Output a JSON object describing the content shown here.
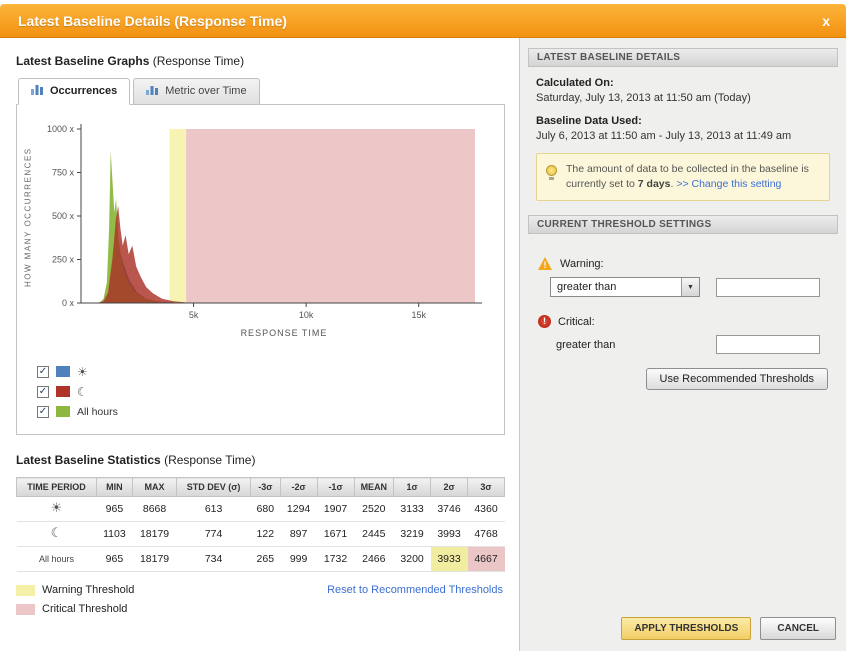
{
  "dialog": {
    "title": "Latest Baseline Details (Response Time)",
    "close_label": "x"
  },
  "graphs": {
    "heading_bold": "Latest Baseline Graphs",
    "heading_suffix": " (Response Time)",
    "tabs": [
      {
        "label": "Occurrences",
        "active": true
      },
      {
        "label": "Metric over Time",
        "active": false
      }
    ]
  },
  "chart_data": {
    "type": "area",
    "title": "",
    "xlabel": "RESPONSE TIME",
    "ylabel": "HOW MANY OCCURRENCES",
    "xlim": [
      0,
      17500
    ],
    "ylim": [
      0,
      1000
    ],
    "x_ticks": [
      {
        "value": 5000,
        "label": "5k"
      },
      {
        "value": 10000,
        "label": "10k"
      },
      {
        "value": 15000,
        "label": "15k"
      }
    ],
    "y_ticks": [
      {
        "value": 0,
        "label": "0 x"
      },
      {
        "value": 250,
        "label": "250 x"
      },
      {
        "value": 500,
        "label": "500 x"
      },
      {
        "value": 750,
        "label": "750 x"
      },
      {
        "value": 1000,
        "label": "1000 x"
      }
    ],
    "thresholds": {
      "warning_start": 3933,
      "critical_start": 4667,
      "warning_color": "#f7f3b3",
      "critical_color": "#edc7c7"
    },
    "series": [
      {
        "name": "Day",
        "color": "#4f81bd",
        "opacity": 1,
        "points": [
          [
            800,
            0
          ],
          [
            1100,
            15
          ],
          [
            1350,
            120
          ],
          [
            1550,
            260
          ],
          [
            1700,
            310
          ],
          [
            1900,
            220
          ],
          [
            2150,
            130
          ],
          [
            2500,
            60
          ],
          [
            2900,
            25
          ],
          [
            3400,
            8
          ],
          [
            4000,
            0
          ]
        ]
      },
      {
        "name": "All hours",
        "color": "#8db73e",
        "opacity": 0.95,
        "points": [
          [
            500,
            0
          ],
          [
            850,
            4
          ],
          [
            1000,
            25
          ],
          [
            1150,
            120
          ],
          [
            1250,
            430
          ],
          [
            1320,
            870
          ],
          [
            1400,
            700
          ],
          [
            1480,
            520
          ],
          [
            1560,
            600
          ],
          [
            1650,
            380
          ],
          [
            1750,
            290
          ],
          [
            1900,
            190
          ],
          [
            2100,
            120
          ],
          [
            2350,
            70
          ],
          [
            2650,
            38
          ],
          [
            3000,
            18
          ],
          [
            3500,
            8
          ],
          [
            4200,
            3
          ],
          [
            5000,
            0
          ]
        ]
      },
      {
        "name": "Night",
        "color": "#a93126",
        "opacity": 0.82,
        "points": [
          [
            700,
            0
          ],
          [
            1000,
            10
          ],
          [
            1200,
            60
          ],
          [
            1400,
            260
          ],
          [
            1550,
            480
          ],
          [
            1650,
            560
          ],
          [
            1750,
            430
          ],
          [
            1850,
            330
          ],
          [
            1980,
            390
          ],
          [
            2120,
            280
          ],
          [
            2280,
            330
          ],
          [
            2450,
            210
          ],
          [
            2650,
            150
          ],
          [
            2900,
            90
          ],
          [
            3200,
            55
          ],
          [
            3600,
            25
          ],
          [
            4100,
            10
          ],
          [
            4700,
            3
          ],
          [
            5400,
            0
          ]
        ]
      }
    ]
  },
  "legend_checkboxes": [
    {
      "icon": "sun-icon",
      "color": "#4f81bd",
      "checked": true,
      "label": ""
    },
    {
      "icon": "moon-icon",
      "color": "#b03329",
      "checked": true,
      "label": ""
    },
    {
      "icon": null,
      "color": "#8db73e",
      "checked": true,
      "label": "All hours"
    }
  ],
  "statistics": {
    "heading_bold": "Latest Baseline Statistics",
    "heading_suffix": " (Response Time)",
    "columns": [
      "TIME PERIOD",
      "MIN",
      "MAX",
      "STD DEV (σ)",
      "-3σ",
      "-2σ",
      "-1σ",
      "MEAN",
      "1σ",
      "2σ",
      "3σ"
    ],
    "rows": [
      {
        "icon": "sun-icon",
        "label": "",
        "values": [
          965,
          8668,
          613,
          680,
          1294,
          1907,
          2520,
          3133,
          3746,
          4360
        ],
        "highlights": {}
      },
      {
        "icon": "moon-icon",
        "label": "",
        "values": [
          1103,
          18179,
          774,
          122,
          897,
          1671,
          2445,
          3219,
          3993,
          4768
        ],
        "highlights": {}
      },
      {
        "icon": null,
        "label": "All hours",
        "values": [
          965,
          18179,
          734,
          265,
          999,
          1732,
          2466,
          3200,
          3933,
          4667
        ],
        "highlights": {
          "8": "warning",
          "9": "critical"
        }
      }
    ]
  },
  "threshold_legend": [
    {
      "label": "Warning Threshold",
      "color": "#f4f0a8"
    },
    {
      "label": "Critical Threshold",
      "color": "#edc7c7"
    }
  ],
  "reset_link": "Reset to Recommended Thresholds",
  "sidebar": {
    "details_header": "LATEST BASELINE DETAILS",
    "calculated_on_label": "Calculated On:",
    "calculated_on_value": "Saturday, July 13, 2013 at 11:50 am (Today)",
    "baseline_data_label": "Baseline Data Used:",
    "baseline_data_value": "July 6, 2013 at 11:50 am - July 13, 2013 at 11:49 am",
    "note": {
      "text_before": "The amount of data to be collected in the baseline is currently set to ",
      "days": "7 days",
      "text_after": ". ",
      "link": ">> Change this setting"
    },
    "threshold_header": "CURRENT THRESHOLD SETTINGS",
    "warning_label": "Warning:",
    "warning_operator": "greater than",
    "warning_value": "",
    "critical_label": "Critical:",
    "critical_operator": "greater than",
    "critical_value": "",
    "use_recommended_button": "Use Recommended Thresholds"
  },
  "footer": {
    "apply_button": "APPLY THRESHOLDS",
    "cancel_button": "CANCEL"
  }
}
